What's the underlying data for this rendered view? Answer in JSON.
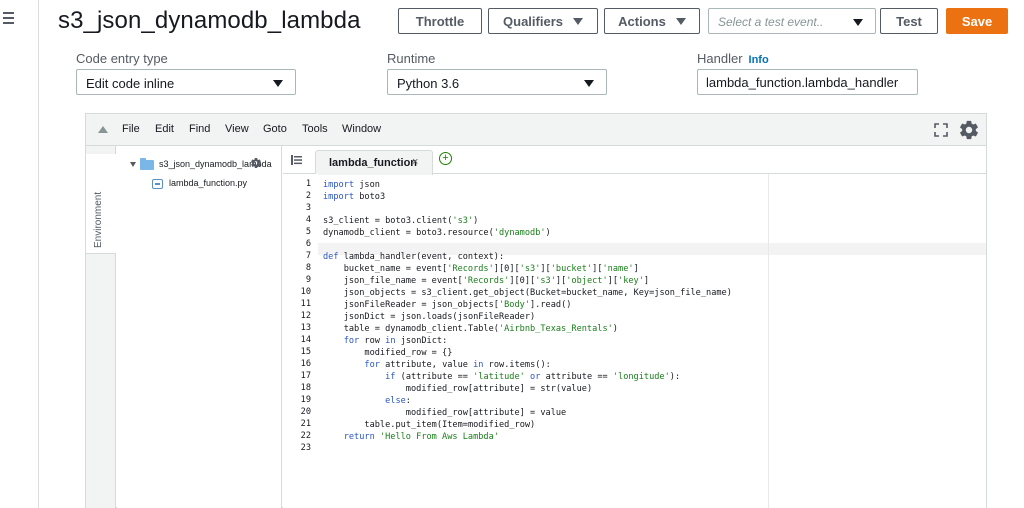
{
  "function_name": "s3_json_dynamodb_lambda",
  "toolbar": {
    "throttle": "Throttle",
    "qualifiers": "Qualifiers",
    "actions": "Actions",
    "test_event_placeholder": "Select a test event..",
    "test": "Test",
    "save": "Save"
  },
  "config": {
    "code_entry_label": "Code entry type",
    "code_entry_value": "Edit code inline",
    "runtime_label": "Runtime",
    "runtime_value": "Python 3.6",
    "handler_label": "Handler",
    "handler_info": "Info",
    "handler_value": "lambda_function.lambda_handler"
  },
  "ide": {
    "menu": [
      "File",
      "Edit",
      "Find",
      "View",
      "Goto",
      "Tools",
      "Window"
    ],
    "environment_label": "Environment",
    "tree_root": "s3_json_dynamodb_lambda",
    "tree_file": "lambda_function.py",
    "active_tab": "lambda_function",
    "tab_close": "×",
    "add_tab": "+"
  },
  "code_lines": [
    "import json",
    "import boto3",
    "",
    "s3_client = boto3.client('s3')",
    "dynamodb_client = boto3.resource('dynamodb')",
    "",
    "def lambda_handler(event, context):",
    "    bucket_name = event['Records'][0]['s3']['bucket']['name']",
    "    json_file_name = event['Records'][0]['s3']['object']['key']",
    "    json_objects = s3_client.get_object(Bucket=bucket_name, Key=json_file_name)",
    "    jsonFileReader = json_objects['Body'].read()",
    "    jsonDict = json.loads(jsonFileReader)",
    "    table = dynamodb_client.Table('Airbnb_Texas_Rentals')",
    "    for row in jsonDict:",
    "        modified_row = {}",
    "        for attribute, value in row.items():",
    "            if (attribute == 'latitude' or attribute == 'longitude'):",
    "                modified_row[attribute] = str(value)",
    "            else:",
    "                modified_row[attribute] = value",
    "        table.put_item(Item=modified_row)",
    "    return 'Hello From Aws Lambda'",
    ""
  ],
  "line_numbers": [
    "1",
    "2",
    "3",
    "4",
    "5",
    "6",
    "7",
    "8",
    "9",
    "10",
    "11",
    "12",
    "13",
    "14",
    "15",
    "16",
    "17",
    "18",
    "19",
    "20",
    "21",
    "22",
    "23"
  ],
  "colors": {
    "primary_button": "#ec7211",
    "info_link": "#0073bb",
    "keyword": "#2a55c0",
    "string": "#1a7e1a"
  },
  "icons": [
    "hamburger-menu-icon",
    "caret-down-icon",
    "fullscreen-icon",
    "gear-icon",
    "folder-icon",
    "python-file-icon",
    "tab-list-icon",
    "close-icon",
    "add-icon"
  ]
}
